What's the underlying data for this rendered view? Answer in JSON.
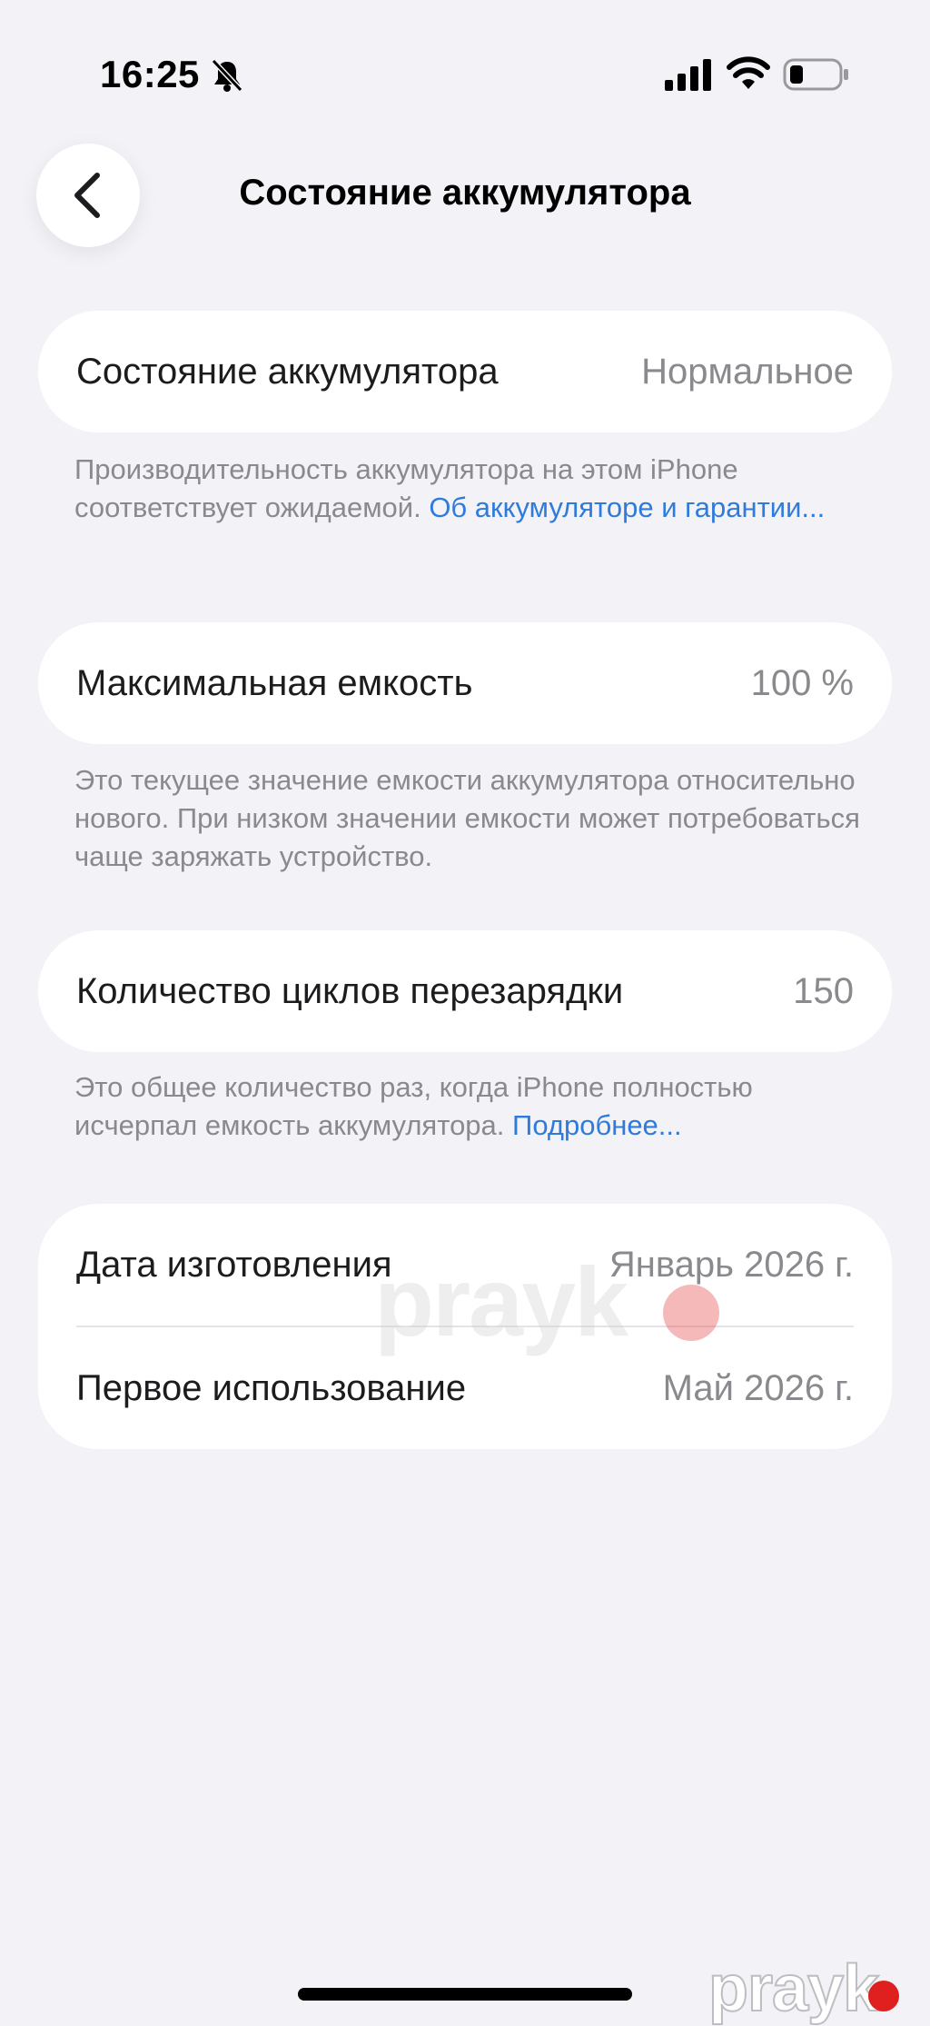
{
  "status_bar": {
    "time": "16:25",
    "icons": [
      "bell-slash-icon",
      "cellular-signal-icon",
      "wifi-icon",
      "battery-low-icon"
    ]
  },
  "nav": {
    "back_icon": "chevron-left-icon",
    "title": "Состояние аккумулятора"
  },
  "battery_health": {
    "label": "Состояние аккумулятора",
    "value": "Нормальное",
    "footnote_text": "Производительность аккумулятора на этом iPhone соответствует ожидаемой.",
    "footnote_link": "Об аккумуляторе и гарантии..."
  },
  "max_capacity": {
    "label": "Максимальная емкость",
    "value": "100 %",
    "footnote_text": "Это текущее значение емкости аккумулятора относительно нового. При низком значении емкости может потребоваться чаще заряжать устройство."
  },
  "cycle_count": {
    "label": "Количество циклов перезарядки",
    "value": "150",
    "footnote_text": "Это общее количество раз, когда iPhone полностью исчерпал емкость аккумулятора.",
    "footnote_link": "Подробнее..."
  },
  "dates": {
    "manufacture_label": "Дата изготовления",
    "manufacture_value": "Январь 2026 г.",
    "first_use_label": "Первое использование",
    "first_use_value": "Май 2026 г."
  },
  "watermark": {
    "text": "prayk",
    "dot_color": "#e0201f"
  },
  "colors": {
    "background": "#f2f2f7",
    "link": "#2f7bdc",
    "secondary_text": "#8a8a8e"
  }
}
